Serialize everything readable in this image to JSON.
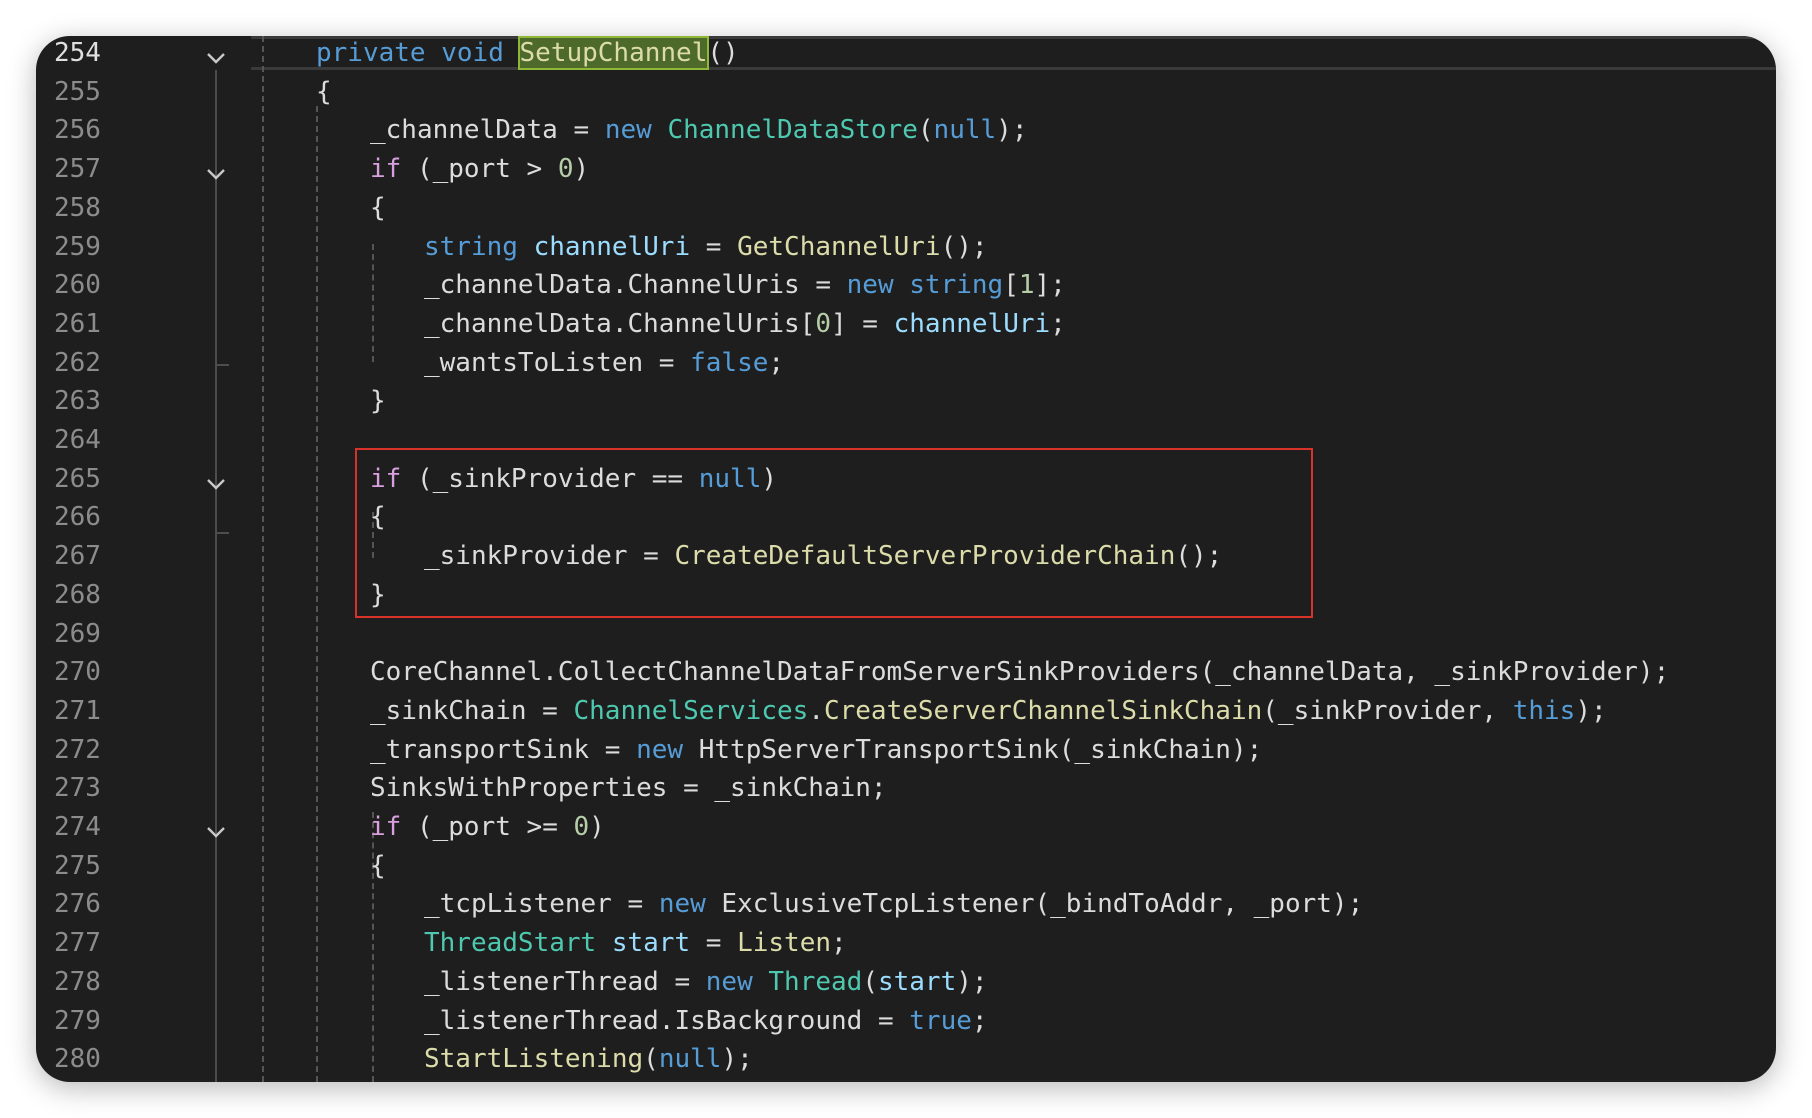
{
  "editor": {
    "theme_colors": {
      "background": "#1e1e1e",
      "keyword": "#569cd6",
      "control": "#d8a0df",
      "type": "#4ec9b0",
      "function": "#dcdcaa",
      "variable": "#9cdcfe",
      "number": "#b5cea8",
      "text": "#dcdcdc",
      "highlight_border": "#d9322a"
    },
    "lines": [
      {
        "n": "254",
        "fold": true,
        "active": true,
        "indent": 0,
        "tokens": [
          [
            "kw",
            "private"
          ],
          [
            "plain",
            " "
          ],
          [
            "kw",
            "void"
          ],
          [
            "plain",
            " "
          ],
          [
            "hl",
            "SetupChannel"
          ],
          [
            "plain",
            "()"
          ]
        ]
      },
      {
        "n": "255",
        "fold": false,
        "indent": 0,
        "tokens": [
          [
            "plain",
            "{"
          ]
        ]
      },
      {
        "n": "256",
        "fold": false,
        "indent": 1,
        "tokens": [
          [
            "plain",
            "_channelData = "
          ],
          [
            "kw",
            "new"
          ],
          [
            "plain",
            " "
          ],
          [
            "type",
            "ChannelDataStore"
          ],
          [
            "plain",
            "("
          ],
          [
            "kw",
            "null"
          ],
          [
            "plain",
            ");"
          ]
        ]
      },
      {
        "n": "257",
        "fold": true,
        "indent": 1,
        "tokens": [
          [
            "ctl",
            "if"
          ],
          [
            "plain",
            " (_port > "
          ],
          [
            "num",
            "0"
          ],
          [
            "plain",
            ")"
          ]
        ]
      },
      {
        "n": "258",
        "fold": false,
        "indent": 1,
        "tokens": [
          [
            "plain",
            "{"
          ]
        ]
      },
      {
        "n": "259",
        "fold": false,
        "indent": 2,
        "tokens": [
          [
            "kw",
            "string"
          ],
          [
            "plain",
            " "
          ],
          [
            "var",
            "channelUri"
          ],
          [
            "plain",
            " = "
          ],
          [
            "fn",
            "GetChannelUri"
          ],
          [
            "plain",
            "();"
          ]
        ]
      },
      {
        "n": "260",
        "fold": false,
        "indent": 2,
        "tokens": [
          [
            "plain",
            "_channelData.ChannelUris = "
          ],
          [
            "kw",
            "new"
          ],
          [
            "plain",
            " "
          ],
          [
            "kw",
            "string"
          ],
          [
            "plain",
            "["
          ],
          [
            "num",
            "1"
          ],
          [
            "plain",
            "];"
          ]
        ]
      },
      {
        "n": "261",
        "fold": false,
        "indent": 2,
        "tokens": [
          [
            "plain",
            "_channelData.ChannelUris["
          ],
          [
            "num",
            "0"
          ],
          [
            "plain",
            "] = "
          ],
          [
            "var",
            "channelUri"
          ],
          [
            "plain",
            ";"
          ]
        ]
      },
      {
        "n": "262",
        "fold": false,
        "indent": 2,
        "tokens": [
          [
            "plain",
            "_wantsToListen = "
          ],
          [
            "kw",
            "false"
          ],
          [
            "plain",
            ";"
          ]
        ]
      },
      {
        "n": "263",
        "fold": false,
        "indent": 1,
        "tokens": [
          [
            "plain",
            "}"
          ]
        ]
      },
      {
        "n": "264",
        "fold": false,
        "indent": 1,
        "tokens": []
      },
      {
        "n": "265",
        "fold": true,
        "indent": 1,
        "tokens": [
          [
            "ctl",
            "if"
          ],
          [
            "plain",
            " (_sinkProvider == "
          ],
          [
            "kw",
            "null"
          ],
          [
            "plain",
            ")"
          ]
        ]
      },
      {
        "n": "266",
        "fold": false,
        "indent": 1,
        "tokens": [
          [
            "plain",
            "{"
          ]
        ]
      },
      {
        "n": "267",
        "fold": false,
        "indent": 2,
        "tokens": [
          [
            "plain",
            "_sinkProvider = "
          ],
          [
            "fn",
            "CreateDefaultServerProviderChain"
          ],
          [
            "plain",
            "();"
          ]
        ]
      },
      {
        "n": "268",
        "fold": false,
        "indent": 1,
        "tokens": [
          [
            "plain",
            "}"
          ]
        ]
      },
      {
        "n": "269",
        "fold": false,
        "indent": 1,
        "tokens": []
      },
      {
        "n": "270",
        "fold": false,
        "indent": 1,
        "tokens": [
          [
            "plain",
            "CoreChannel.CollectChannelDataFromServerSinkProviders(_channelData, _sinkProvider);"
          ]
        ]
      },
      {
        "n": "271",
        "fold": false,
        "indent": 1,
        "tokens": [
          [
            "plain",
            "_sinkChain = "
          ],
          [
            "type",
            "ChannelServices"
          ],
          [
            "plain",
            "."
          ],
          [
            "fn",
            "CreateServerChannelSinkChain"
          ],
          [
            "plain",
            "(_sinkProvider, "
          ],
          [
            "kw",
            "this"
          ],
          [
            "plain",
            ");"
          ]
        ]
      },
      {
        "n": "272",
        "fold": false,
        "indent": 1,
        "tokens": [
          [
            "plain",
            "_transportSink = "
          ],
          [
            "kw",
            "new"
          ],
          [
            "plain",
            " HttpServerTransportSink(_sinkChain);"
          ]
        ]
      },
      {
        "n": "273",
        "fold": false,
        "indent": 1,
        "tokens": [
          [
            "plain",
            "SinksWithProperties = _sinkChain;"
          ]
        ]
      },
      {
        "n": "274",
        "fold": true,
        "indent": 1,
        "tokens": [
          [
            "ctl",
            "if"
          ],
          [
            "plain",
            " (_port >= "
          ],
          [
            "num",
            "0"
          ],
          [
            "plain",
            ")"
          ]
        ]
      },
      {
        "n": "275",
        "fold": false,
        "indent": 1,
        "tokens": [
          [
            "plain",
            "{"
          ]
        ]
      },
      {
        "n": "276",
        "fold": false,
        "indent": 2,
        "tokens": [
          [
            "plain",
            "_tcpListener = "
          ],
          [
            "kw",
            "new"
          ],
          [
            "plain",
            " ExclusiveTcpListener(_bindToAddr, _port);"
          ]
        ]
      },
      {
        "n": "277",
        "fold": false,
        "indent": 2,
        "tokens": [
          [
            "type",
            "ThreadStart"
          ],
          [
            "plain",
            " "
          ],
          [
            "var",
            "start"
          ],
          [
            "plain",
            " = "
          ],
          [
            "fn",
            "Listen"
          ],
          [
            "plain",
            ";"
          ]
        ]
      },
      {
        "n": "278",
        "fold": false,
        "indent": 2,
        "tokens": [
          [
            "plain",
            "_listenerThread = "
          ],
          [
            "kw",
            "new"
          ],
          [
            "plain",
            " "
          ],
          [
            "type",
            "Thread"
          ],
          [
            "plain",
            "("
          ],
          [
            "var",
            "start"
          ],
          [
            "plain",
            ");"
          ]
        ]
      },
      {
        "n": "279",
        "fold": false,
        "indent": 2,
        "tokens": [
          [
            "plain",
            "_listenerThread.IsBackground = "
          ],
          [
            "kw",
            "true"
          ],
          [
            "plain",
            ";"
          ]
        ]
      },
      {
        "n": "280",
        "fold": false,
        "indent": 2,
        "tokens": [
          [
            "fn",
            "StartListening"
          ],
          [
            "plain",
            "("
          ],
          [
            "kw",
            "null"
          ],
          [
            "plain",
            ");"
          ]
        ]
      }
    ]
  }
}
